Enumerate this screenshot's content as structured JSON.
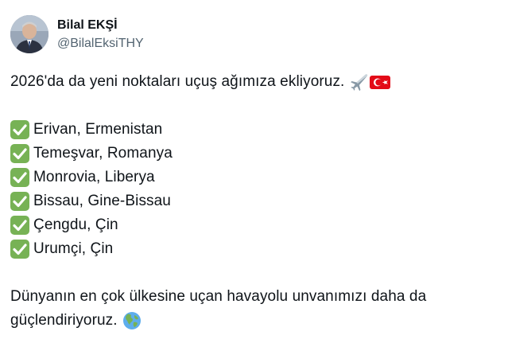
{
  "author": {
    "display_name": "Bilal EKŞİ",
    "handle": "@BilalEksiTHY"
  },
  "tweet": {
    "intro": "2026'da da yeni noktaları uçuş ağımıza ekliyoruz.",
    "intro_icons": [
      "airplane-emoji",
      "turkey-flag-emoji"
    ],
    "destinations": [
      "Erivan, Ermenistan",
      "Temeşvar, Romanya",
      "Monrovia, Liberya",
      "Bissau, Gine-Bissau",
      "Çengdu, Çin",
      "Urumçi, Çin"
    ],
    "list_icon": "check-mark-button-emoji",
    "closing_line1": "Dünyanın en çok ülkesine uçan havayolu unvanımızı daha da",
    "closing_line2": "güçlendiriyoruz.",
    "closing_icon": "globe-emoji"
  },
  "colors": {
    "text": "#0f1419",
    "secondary_text": "#536471",
    "check_green": "#77b255",
    "flag_red": "#e30a17"
  }
}
